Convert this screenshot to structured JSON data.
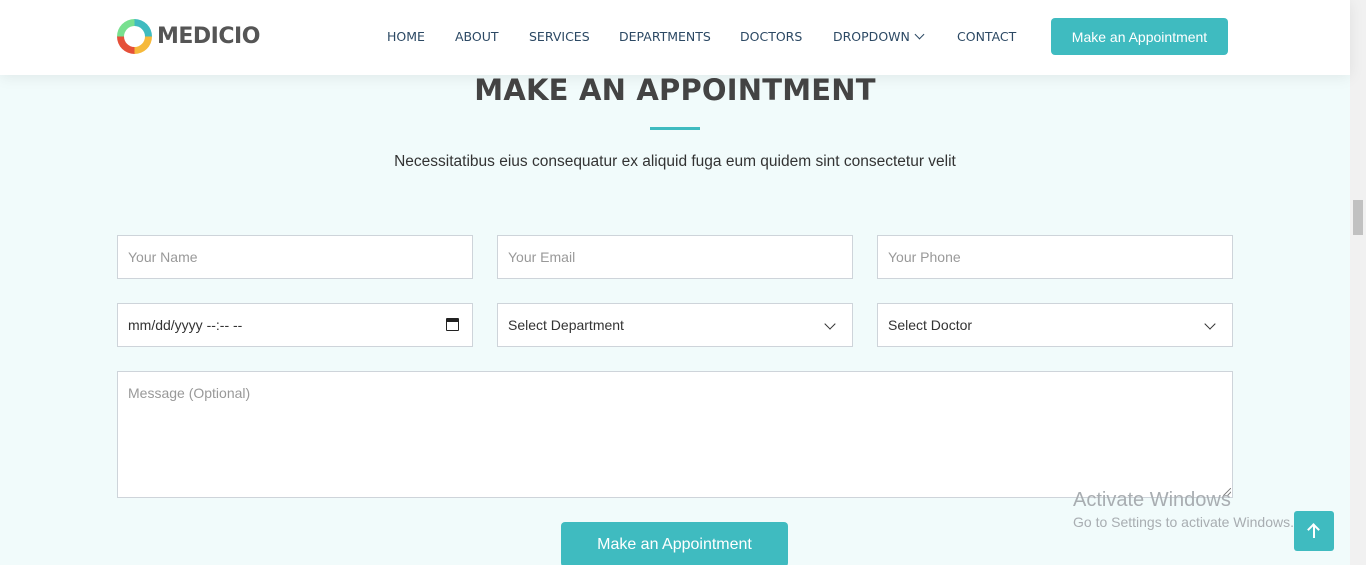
{
  "header": {
    "logo_text": "MEDICIO",
    "nav": [
      {
        "label": "HOME"
      },
      {
        "label": "ABOUT"
      },
      {
        "label": "SERVICES"
      },
      {
        "label": "DEPARTMENTS"
      },
      {
        "label": "DOCTORS"
      },
      {
        "label": "DROPDOWN",
        "icon": "chevron-down-icon"
      },
      {
        "label": "CONTACT"
      }
    ],
    "cta_label": "Make an Appointment"
  },
  "section": {
    "title": "MAKE AN APPOINTMENT",
    "subtitle": "Necessitatibus eius consequatur ex aliquid fuga eum quidem sint consectetur velit"
  },
  "form": {
    "name_placeholder": "Your Name",
    "email_placeholder": "Your Email",
    "phone_placeholder": "Your Phone",
    "date_value": "mm/dd/yyyy --:-- --",
    "department_selected": "Select Department",
    "doctor_selected": "Select Doctor",
    "message_placeholder": "Message (Optional)",
    "submit_label": "Make an Appointment"
  },
  "overlay": {
    "activate_title": "Activate Windows",
    "activate_subtitle": "Go to Settings to activate Windows."
  },
  "colors": {
    "accent": "#3fbbc0",
    "page_background": "#f1fbfb",
    "nav_text": "#2c4964"
  }
}
